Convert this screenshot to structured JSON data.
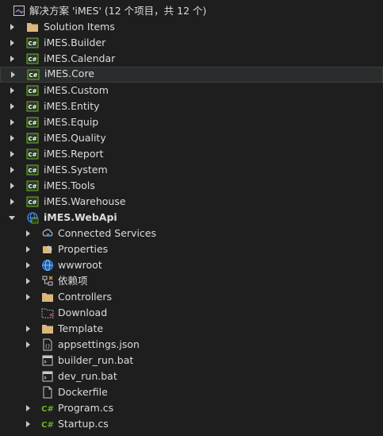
{
  "solution": {
    "label": "解决方案 'iMES' (12 个项目，共 12 个)",
    "icon": "solution-icon"
  },
  "projects": [
    {
      "label": "Solution Items",
      "icon": "folder-icon"
    },
    {
      "label": "iMES.Builder",
      "icon": "csharp-project-icon"
    },
    {
      "label": "iMES.Calendar",
      "icon": "csharp-project-icon"
    },
    {
      "label": "iMES.Core",
      "icon": "csharp-project-icon",
      "selected": true
    },
    {
      "label": "iMES.Custom",
      "icon": "csharp-project-icon"
    },
    {
      "label": "iMES.Entity",
      "icon": "csharp-project-icon"
    },
    {
      "label": "iMES.Equip",
      "icon": "csharp-project-icon"
    },
    {
      "label": "iMES.Quality",
      "icon": "csharp-project-icon"
    },
    {
      "label": "iMES.Report",
      "icon": "csharp-project-icon"
    },
    {
      "label": "iMES.System",
      "icon": "csharp-project-icon"
    },
    {
      "label": "iMES.Tools",
      "icon": "csharp-project-icon"
    },
    {
      "label": "iMES.Warehouse",
      "icon": "csharp-project-icon"
    }
  ],
  "webapi": {
    "label": "iMES.WebApi",
    "icon": "web-project-icon",
    "children": [
      {
        "label": "Connected Services",
        "icon": "connected-services-icon"
      },
      {
        "label": "Properties",
        "icon": "properties-icon"
      },
      {
        "label": "wwwroot",
        "icon": "globe-icon"
      },
      {
        "label": "依赖项",
        "icon": "dependencies-icon"
      },
      {
        "label": "Controllers",
        "icon": "folder-icon"
      },
      {
        "label": "Download",
        "icon": "excluded-folder-icon"
      },
      {
        "label": "Template",
        "icon": "folder-icon"
      },
      {
        "label": "appsettings.json",
        "icon": "json-file-icon"
      },
      {
        "label": "builder_run.bat",
        "icon": "bat-file-icon"
      },
      {
        "label": "dev_run.bat",
        "icon": "bat-file-icon"
      },
      {
        "label": "Dockerfile",
        "icon": "file-icon"
      },
      {
        "label": "Program.cs",
        "icon": "csharp-file-icon"
      },
      {
        "label": "Startup.cs",
        "icon": "csharp-file-icon"
      }
    ]
  },
  "colors": {
    "background": "#1e1e1e",
    "text": "#dcdcdc",
    "selection": "#2a2d2e",
    "folder": "#dcb67a",
    "csharp": "#68b723",
    "web": "#3b8eea",
    "vs_purple": "#a074c4"
  }
}
